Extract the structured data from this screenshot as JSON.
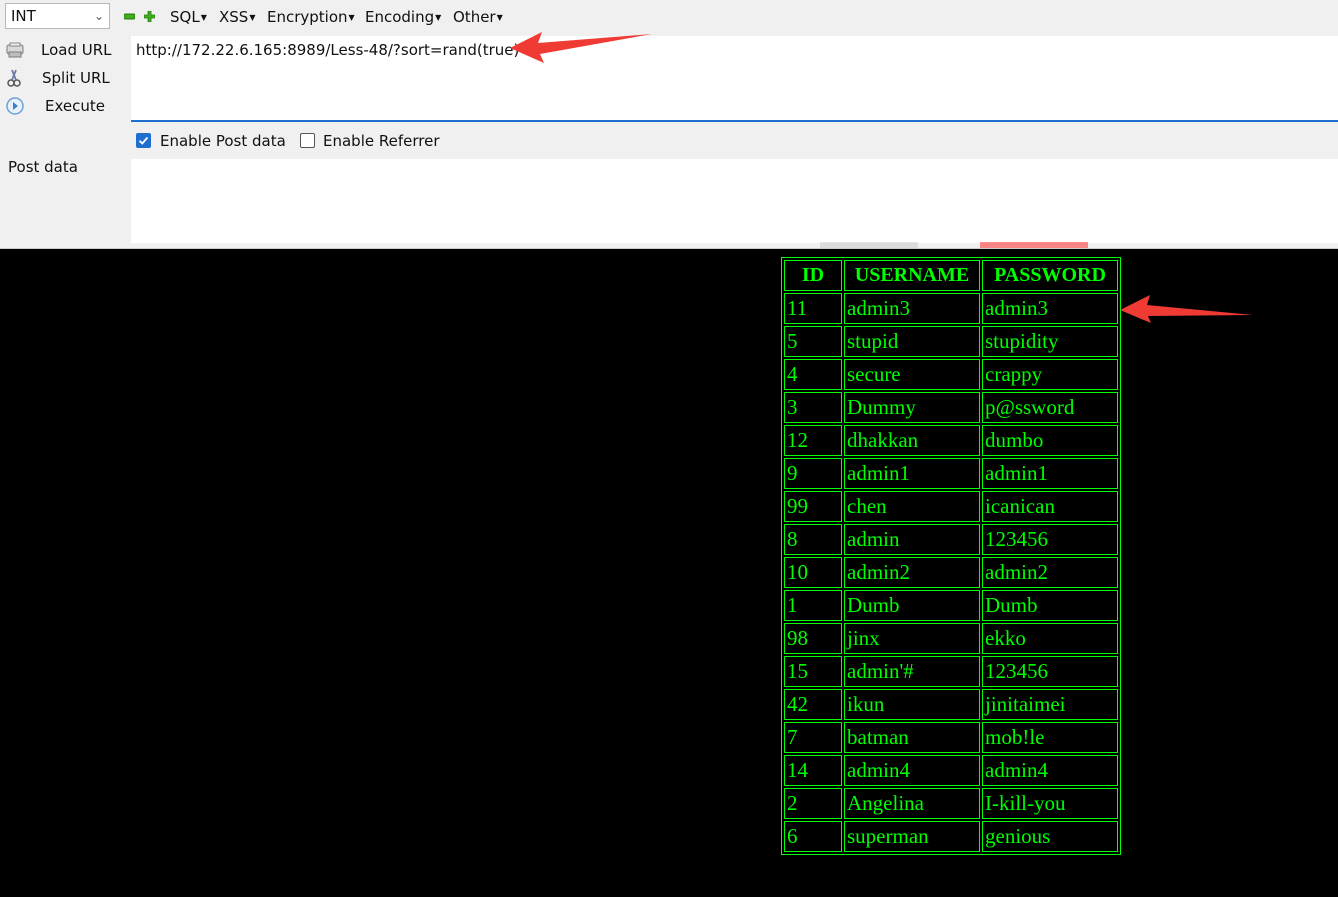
{
  "toolbar": {
    "type_select": "INT",
    "menus": [
      "SQL",
      "XSS",
      "Encryption",
      "Encoding",
      "Other"
    ]
  },
  "side_buttons": [
    {
      "label": "Load URL",
      "icon": "load-url-icon"
    },
    {
      "label": "Split URL",
      "icon": "split-url-icon"
    },
    {
      "label": "Execute",
      "icon": "execute-icon"
    }
  ],
  "url": "http://172.22.6.165:8989/Less-48/?sort=rand(true)",
  "options": {
    "enable_post_label": "Enable Post data",
    "enable_post_checked": true,
    "enable_referrer_label": "Enable Referrer",
    "enable_referrer_checked": false
  },
  "post_data": {
    "label": "Post data",
    "value": ""
  },
  "table": {
    "headers": [
      "ID",
      "USERNAME",
      "PASSWORD"
    ],
    "rows": [
      [
        "11",
        "admin3",
        "admin3"
      ],
      [
        "5",
        "stupid",
        "stupidity"
      ],
      [
        "4",
        "secure",
        "crappy"
      ],
      [
        "3",
        "Dummy",
        "p@ssword"
      ],
      [
        "12",
        "dhakkan",
        "dumbo"
      ],
      [
        "9",
        "admin1",
        "admin1"
      ],
      [
        "99",
        "chen",
        "icanican"
      ],
      [
        "8",
        "admin",
        "123456"
      ],
      [
        "10",
        "admin2",
        "admin2"
      ],
      [
        "1",
        "Dumb",
        "Dumb"
      ],
      [
        "98",
        "jinx",
        "ekko"
      ],
      [
        "15",
        "admin'#",
        "123456"
      ],
      [
        "42",
        "ikun",
        "jinitaimei"
      ],
      [
        "7",
        "batman",
        "mob!le"
      ],
      [
        "14",
        "admin4",
        "admin4"
      ],
      [
        "2",
        "Angelina",
        "I-kill-you"
      ],
      [
        "6",
        "superman",
        "genious"
      ]
    ]
  },
  "colors": {
    "table_text": "#00ff00",
    "page_background": "#000000",
    "annotation_arrow": "#ef3b34",
    "url_focus_border": "#1e6fd0"
  }
}
